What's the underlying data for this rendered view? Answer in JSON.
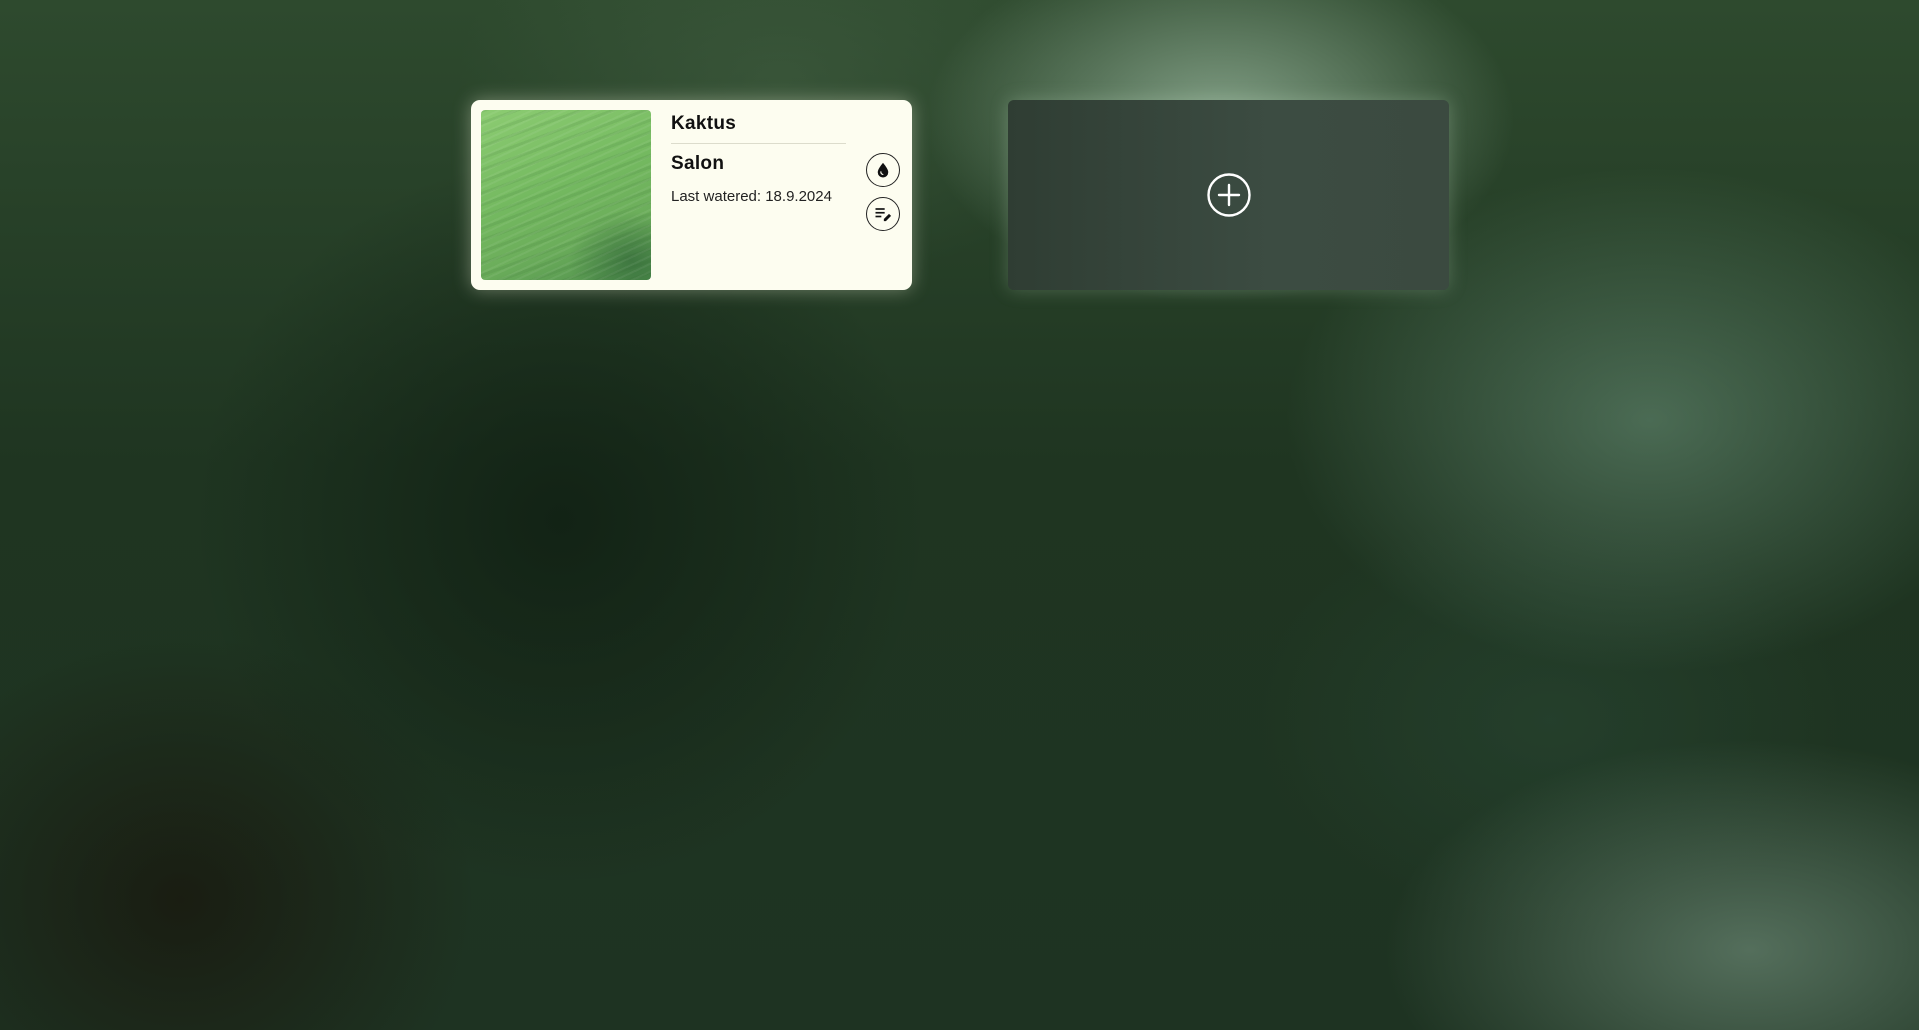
{
  "plants": [
    {
      "name": "Kaktus",
      "room": "Salon",
      "last_watered": "Last watered: 18.9.2024",
      "photo_icon": "plant-photo",
      "actions": {
        "water_icon": "water-drop-icon",
        "edit_icon": "edit-notes-icon"
      }
    }
  ],
  "add_card": {
    "icon": "add-circle-icon"
  },
  "colors": {
    "card_background": "#fdfdf0",
    "add_card_background": "#354439",
    "text": "#111111"
  }
}
